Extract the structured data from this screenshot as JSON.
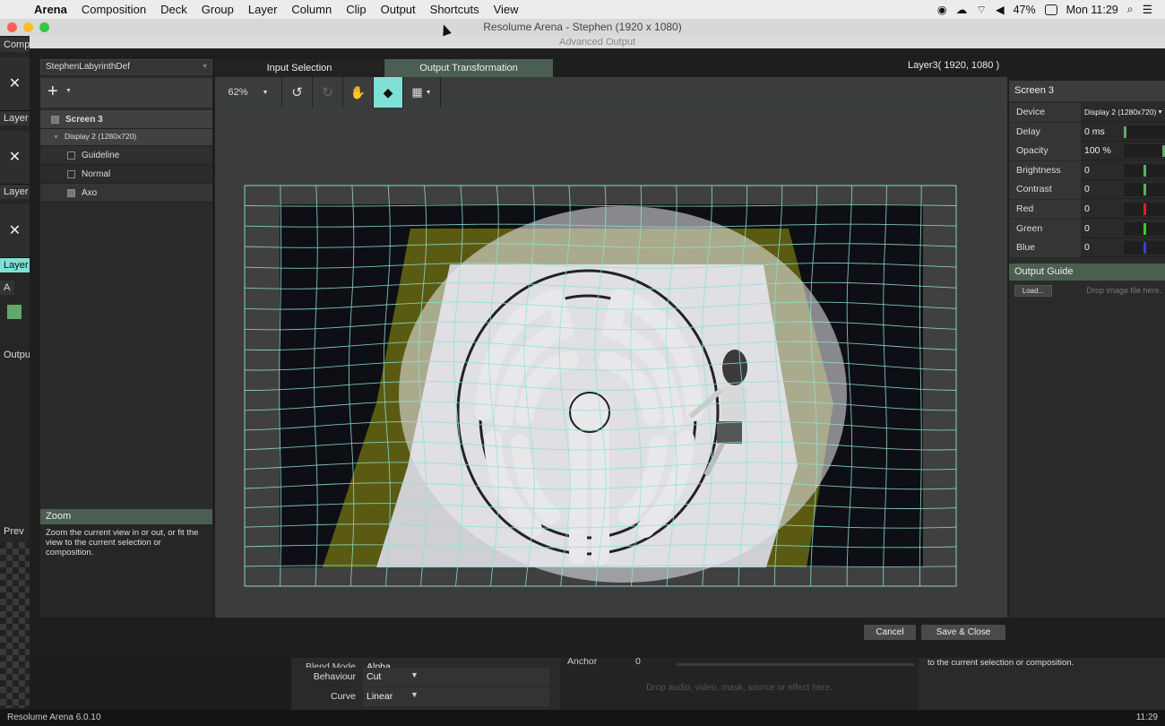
{
  "menubar": {
    "app": "Arena",
    "items": [
      "Composition",
      "Deck",
      "Group",
      "Layer",
      "Column",
      "Clip",
      "Output",
      "Shortcuts",
      "View"
    ],
    "battery": "47%",
    "clock": "Mon 11:29"
  },
  "main_window": {
    "title": "Resolume Arena - Stephen (1920 x 1080)"
  },
  "background": {
    "comp_label": "Comp",
    "layer_label": "Layer",
    "a_label": "A",
    "output_label": "Outpu",
    "preview_label": "Prev",
    "version": "Resolume Arena 6.0.10",
    "time": "11:29",
    "blend_label": "Blend Mode",
    "blend_value": "Alpha",
    "behaviour_label": "Behaviour",
    "behaviour_value": "Cut",
    "curve_label": "Curve",
    "curve_value": "Linear",
    "anchor_label": "Anchor",
    "anchor_value": "0",
    "drop_text": "Drop audio, video, mask, source or effect here.",
    "help_tail": "to the current selection or composition."
  },
  "dialog": {
    "title": "Advanced Output",
    "preset": "StephenLabyrinthDef",
    "tabs": [
      "Input Selection",
      "Output Transformation"
    ],
    "layer_info": "Layer3( 1920, 1080 )",
    "zoom_value": "62%",
    "tree": {
      "screen": "Screen 3",
      "display": "Display 2 (1280x720)",
      "slices": [
        "Guideline",
        "Normal",
        "Axo"
      ]
    },
    "help": {
      "title": "Zoom",
      "text": "Zoom the current view in or out, or fit the view to the current selection or composition."
    },
    "screen_panel": {
      "title": "Screen 3",
      "properties": [
        {
          "name": "Device",
          "value": "Display 2 (1280x720)"
        },
        {
          "name": "Delay",
          "value": "0 ms",
          "level": 0.0,
          "color": "#5fa86e"
        },
        {
          "name": "Opacity",
          "value": "100 %",
          "level": 1.0,
          "color": "#5fa86e"
        },
        {
          "name": "Brightness",
          "value": "0",
          "level": 0.5,
          "color": "#5fa86e"
        },
        {
          "name": "Contrast",
          "value": "0",
          "level": 0.5,
          "color": "#5fa86e"
        },
        {
          "name": "Red",
          "value": "0",
          "level": 0.5,
          "color": "#e02020"
        },
        {
          "name": "Green",
          "value": "0",
          "level": 0.5,
          "color": "#30d030"
        },
        {
          "name": "Blue",
          "value": "0",
          "level": 0.5,
          "color": "#3040f0"
        }
      ],
      "output_guide": "Output Guide",
      "load": "Load...",
      "drop": "Drop image file here."
    },
    "buttons": {
      "cancel": "Cancel",
      "save": "Save & Close"
    }
  }
}
